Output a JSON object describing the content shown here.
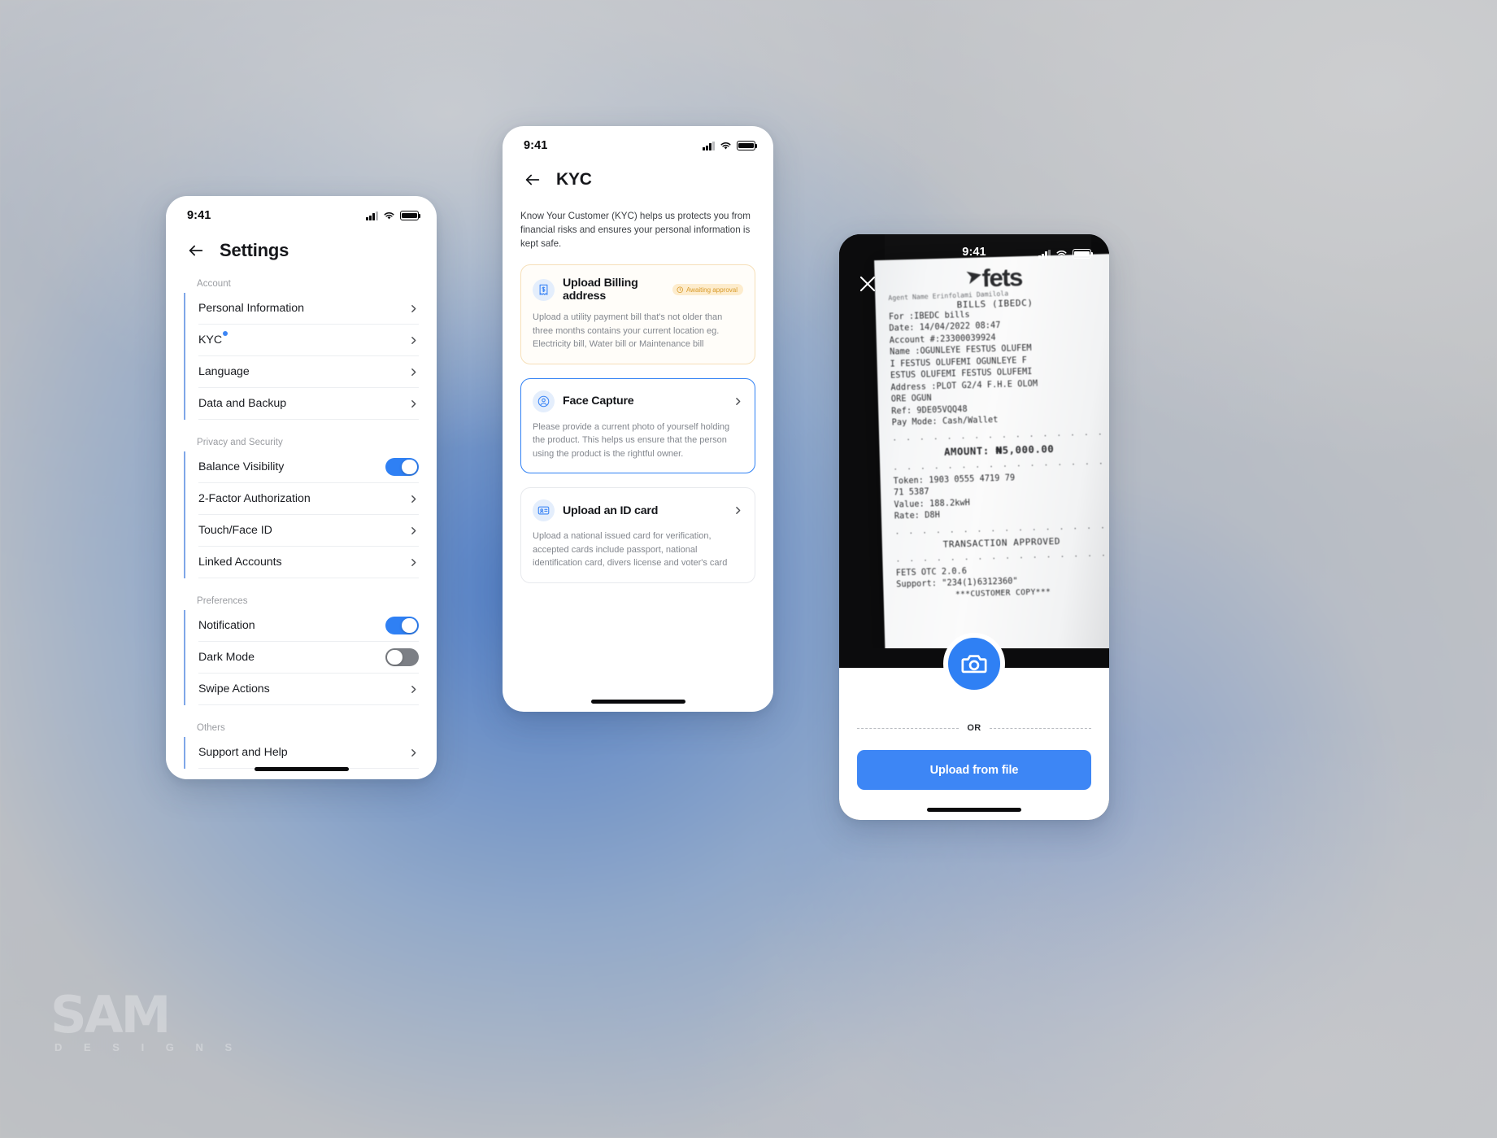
{
  "watermark": {
    "name": "SAM",
    "sub": "D E S I G N S"
  },
  "phones": {
    "settings": {
      "status": {
        "time": "9:41"
      },
      "nav": {
        "title": "Settings",
        "back_icon": "arrow-left-icon"
      },
      "groups": [
        {
          "label": "Account",
          "items": [
            {
              "label": "Personal Information",
              "control": "chevron",
              "dot": false
            },
            {
              "label": "KYC",
              "control": "chevron",
              "dot": true
            },
            {
              "label": "Language",
              "control": "chevron",
              "dot": false
            },
            {
              "label": "Data and Backup",
              "control": "chevron",
              "dot": false
            }
          ]
        },
        {
          "label": "Privacy and Security",
          "items": [
            {
              "label": "Balance Visibility",
              "control": "toggle",
              "on": true
            },
            {
              "label": "2-Factor Authorization",
              "control": "chevron"
            },
            {
              "label": "Touch/Face ID",
              "control": "chevron"
            },
            {
              "label": "Linked Accounts",
              "control": "chevron"
            }
          ]
        },
        {
          "label": "Preferences",
          "items": [
            {
              "label": "Notification",
              "control": "toggle",
              "on": true
            },
            {
              "label": "Dark Mode",
              "control": "toggle",
              "on": false
            },
            {
              "label": "Swipe Actions",
              "control": "chevron"
            }
          ]
        },
        {
          "label": "Others",
          "items": [
            {
              "label": "Support and Help",
              "control": "chevron"
            }
          ]
        }
      ]
    },
    "kyc": {
      "status": {
        "time": "9:41"
      },
      "nav": {
        "title": "KYC",
        "back_icon": "arrow-left-icon"
      },
      "intro": "Know Your Customer (KYC) helps us protects you from financial risks and ensures your personal information is kept safe.",
      "cards": [
        {
          "title": "Upload Billing address",
          "icon": "receipt-bill-icon",
          "badge": {
            "text": "Awaiting approval",
            "icon": "clock-icon",
            "color": "#d99b2a",
            "bg": "#fdeccd"
          },
          "desc": "Upload a utility payment bill that's not older than three months contains your current location eg. Electricity bill, Water bill or Maintenance bill",
          "state": "pending",
          "chevron": false
        },
        {
          "title": "Face Capture",
          "icon": "user-circle-icon",
          "desc": "Please provide a current photo of yourself holding the product. This helps us ensure that the person using the product is the rightful owner.",
          "state": "active",
          "chevron": true
        },
        {
          "title": "Upload an ID card",
          "icon": "id-card-icon",
          "desc": "Upload a national issued card for verification, accepted cards include passport, national identification card, divers license and voter's card",
          "state": "plain",
          "chevron": true
        }
      ]
    },
    "camera": {
      "status": {
        "time": "9:41"
      },
      "close_icon": "close-x-icon",
      "shutter_icon": "camera-icon",
      "or_label": "OR",
      "upload_label": "Upload from file",
      "receipt": {
        "brand": "fets",
        "agent": "Agent Name  Erinfolami Damilola",
        "bills": "BILLS (IBEDC)",
        "lines": [
          "For :IBEDC bills",
          "Date: 14/04/2022 08:47",
          "Account #:23300039924",
          "Name :OGUNLEYE  FESTUS OLUFEM",
          "I  FESTUS OLUFEMI OGUNLEYE  F",
          "ESTUS OLUFEMI  FESTUS OLUFEMI",
          "Address :PLOT G2/4 F.H.E OLOM",
          "ORE  OGUN",
          "Ref:  9DE05VQQ48",
          "Pay Mode:   Cash/Wallet"
        ],
        "amount": "AMOUNT: ₦5,000.00",
        "lines2": [
          "Token:    1903  0555  4719  79",
          "71  5387",
          "Value:    188.2kwH",
          "Rate:     D8H"
        ],
        "approved": "TRANSACTION APPROVED",
        "lines3": [
          "FETS OTC 2.0.6",
          "Support: \"234(1)6312360\""
        ],
        "copy": "***CUSTOMER COPY***"
      }
    }
  }
}
